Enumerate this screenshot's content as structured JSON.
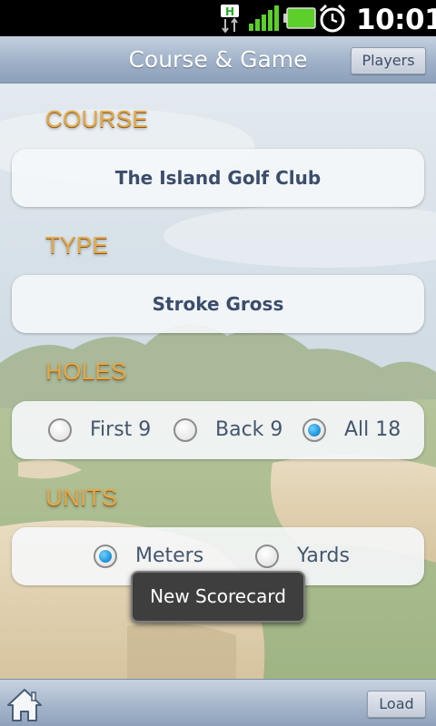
{
  "status_bar": {
    "time": "10:01",
    "icons": [
      "h-data-icon",
      "signal-icon",
      "battery-icon",
      "alarm-icon"
    ]
  },
  "header": {
    "title": "Course & Game",
    "players_label": "Players"
  },
  "course": {
    "label": "COURSE",
    "value": "The Island Golf Club"
  },
  "type": {
    "label": "TYPE",
    "value": "Stroke Gross"
  },
  "holes": {
    "label": "HOLES",
    "options": [
      {
        "label": "First 9",
        "selected": false
      },
      {
        "label": "Back 9",
        "selected": false
      },
      {
        "label": "All 18",
        "selected": true
      }
    ]
  },
  "units": {
    "label": "UNITS",
    "options": [
      {
        "label": "Meters",
        "selected": true
      },
      {
        "label": "Yards",
        "selected": false
      }
    ]
  },
  "toast": {
    "text": "New Scorecard"
  },
  "footer": {
    "home_icon": "home-icon",
    "load_label": "Load"
  },
  "colors": {
    "section_label": "#e3a94a",
    "panel_text": "#3b4d6b",
    "radio_selected": "#1a8fd6",
    "toolbar": "#9fb1c8"
  }
}
